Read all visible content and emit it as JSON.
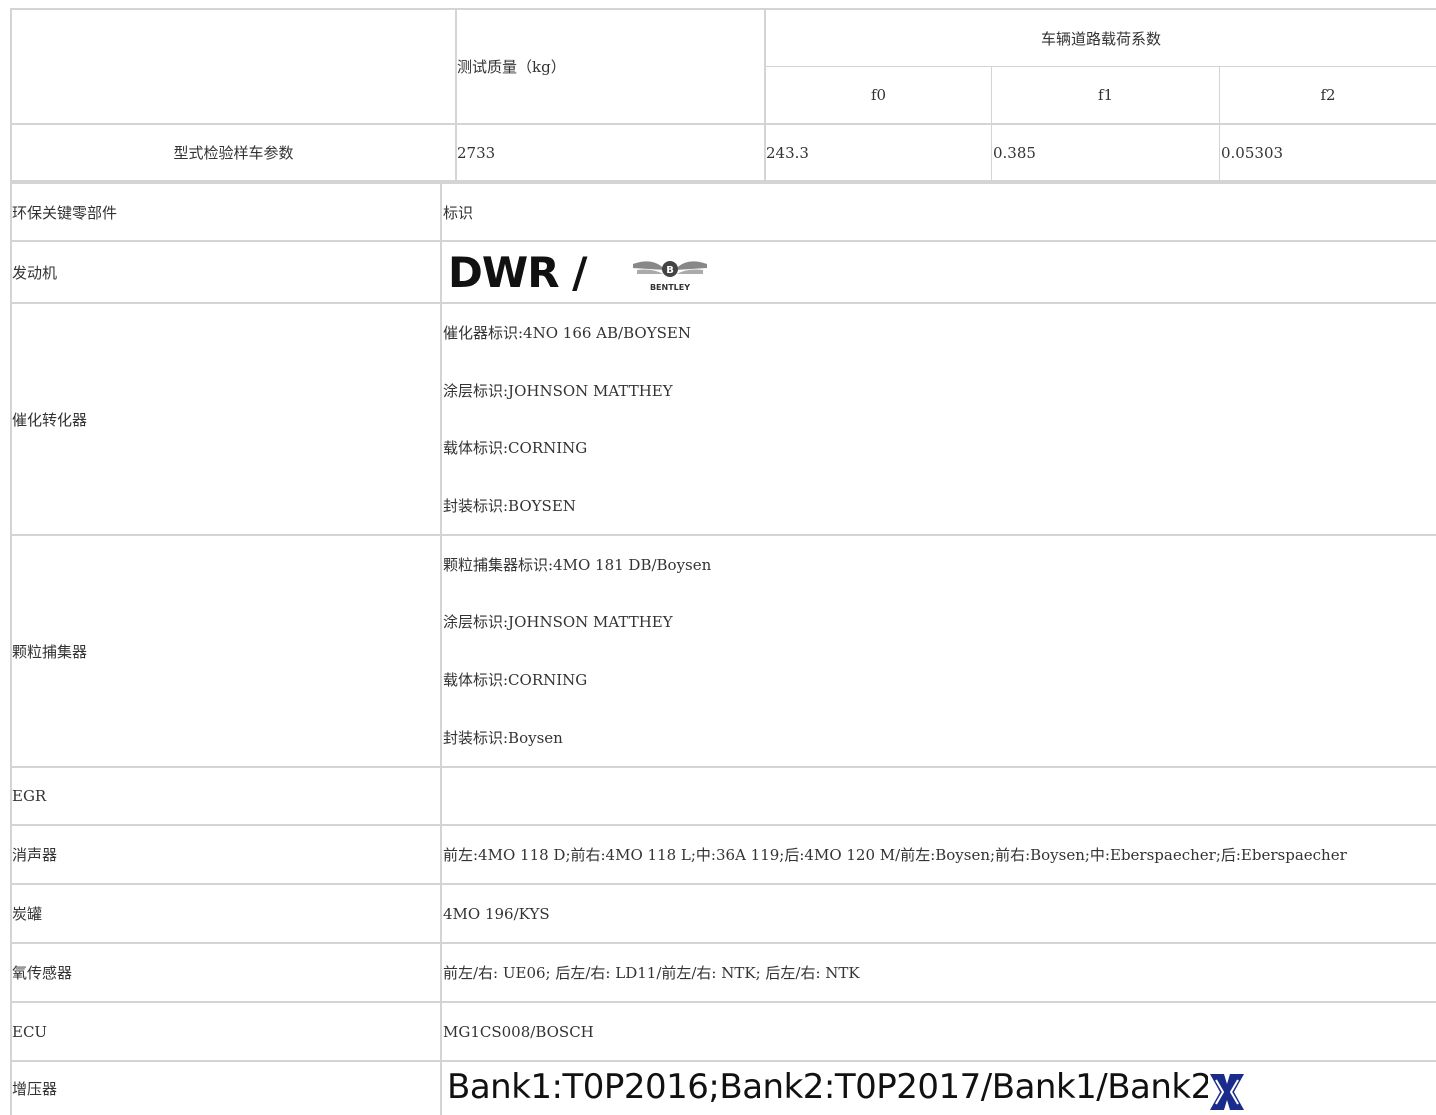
{
  "top_table": {
    "header_mass": "测试质量（kg）",
    "header_coeff": "车辆道路载荷系数",
    "coeff_cols": [
      "f0",
      "f1",
      "f2"
    ],
    "row_label": "型式检验样车参数",
    "mass_value": "2733",
    "coeff_values": [
      "243.3",
      "0.385",
      "0.05303"
    ]
  },
  "parts_table": {
    "header_component": "环保关键零部件",
    "header_mark": "标识",
    "engine": {
      "label": "发动机",
      "logo_text": "DWR /",
      "brand_logo": "BENTLEY"
    },
    "catalyst": {
      "label": "催化转化器",
      "lines": [
        "催化器标识:4NO 166 AB/BOYSEN",
        "涂层标识:JOHNSON MATTHEY",
        "载体标识:CORNING",
        "封装标识:BOYSEN"
      ]
    },
    "particulate": {
      "label": "颗粒捕集器",
      "lines": [
        "颗粒捕集器标识:4MO 181 DB/Boysen",
        "涂层标识:JOHNSON MATTHEY",
        "载体标识:CORNING",
        "封装标识:Boysen"
      ]
    },
    "egr": {
      "label": "EGR",
      "value": ""
    },
    "muffler": {
      "label": "消声器",
      "value": "前左:4MO 118 D;前右:4MO 118 L;中:36A 119;后:4MO 120 M/前左:Boysen;前右:Boysen;中:Eberspaecher;后:Eberspaecher"
    },
    "canister": {
      "label": "炭罐",
      "value": "4MO 196/KYS"
    },
    "o2_sensor": {
      "label": "氧传感器",
      "value": "前左/右: UE06; 后左/右: LD11/前左/右: NTK; 后左/右: NTK"
    },
    "ecu": {
      "label": "ECU",
      "value": "MG1CS008/BOSCH"
    },
    "turbo": {
      "label": "增压器",
      "value_image_text": "Bank1:T0P2016;Bank2:T0P2017/Bank1/Bank2:",
      "logo_icon": "turbo-brand-icon"
    }
  }
}
